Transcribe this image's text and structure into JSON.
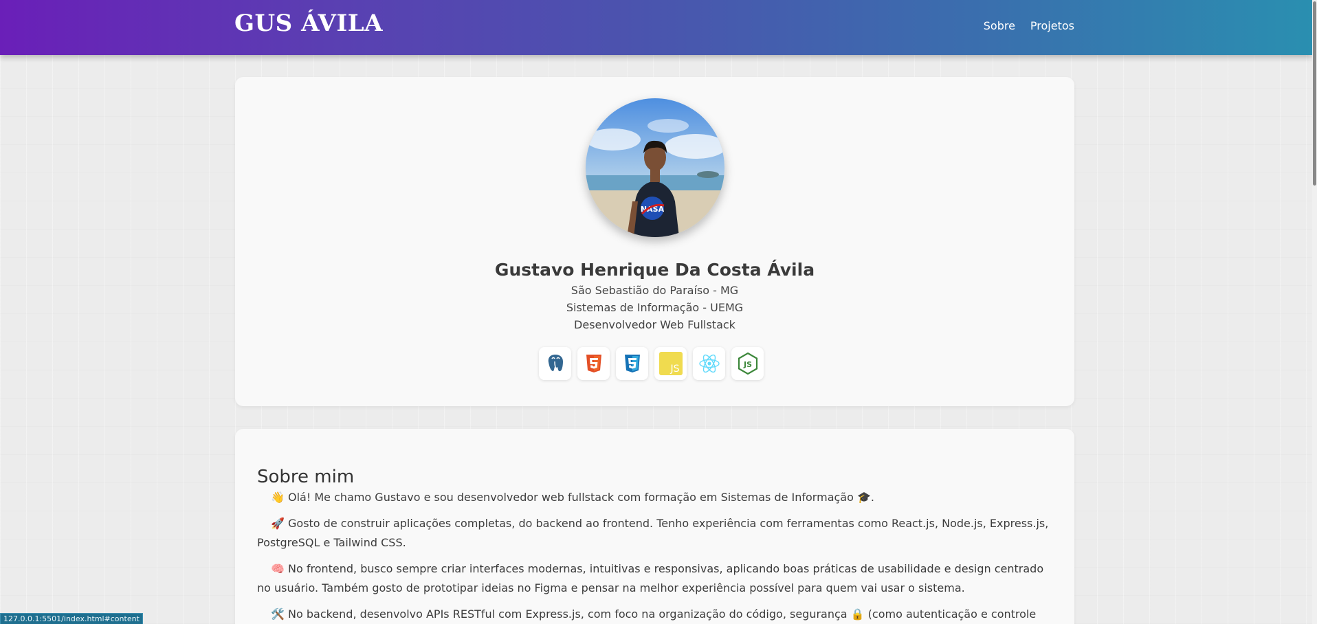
{
  "header": {
    "logo": "GUS ÁVILA",
    "nav": [
      "Sobre",
      "Projetos"
    ]
  },
  "profile": {
    "name": "Gustavo Henrique Da Costa Ávila",
    "location": "São Sebastião do Paraíso - MG",
    "education": "Sistemas de Informação - UEMG",
    "role": "Desenvolvedor Web Fullstack",
    "avatar_icon": "profile-photo",
    "techs": [
      "postgresql-icon",
      "html5-icon",
      "css3-icon",
      "javascript-icon",
      "react-icon",
      "nodejs-icon"
    ]
  },
  "about": {
    "title": "Sobre mim",
    "paragraphs": [
      "👋 Olá! Me chamo Gustavo e sou desenvolvedor web fullstack com formação em Sistemas de Informação 🎓.",
      "🚀 Gosto de construir aplicações completas, do backend ao frontend. Tenho experiência com ferramentas como React.js, Node.js, Express.js, PostgreSQL e Tailwind CSS.",
      "🧠 No frontend, busco sempre criar interfaces modernas, intuitivas e responsivas, aplicando boas práticas de usabilidade e design centrado no usuário. Também gosto de prototipar ideias no Figma e pensar na melhor experiência possível para quem vai usar o sistema.",
      "🛠️ No backend, desenvolvo APIs RESTful com Express.js, com foco na organização do código, segurança 🔒 (como autenticação e controle de"
    ]
  },
  "status_bar": {
    "url": "127.0.0.1:5501/index.html#content"
  },
  "colors": {
    "header_start": "#6a1fb8",
    "header_end": "#2a8fb0"
  }
}
